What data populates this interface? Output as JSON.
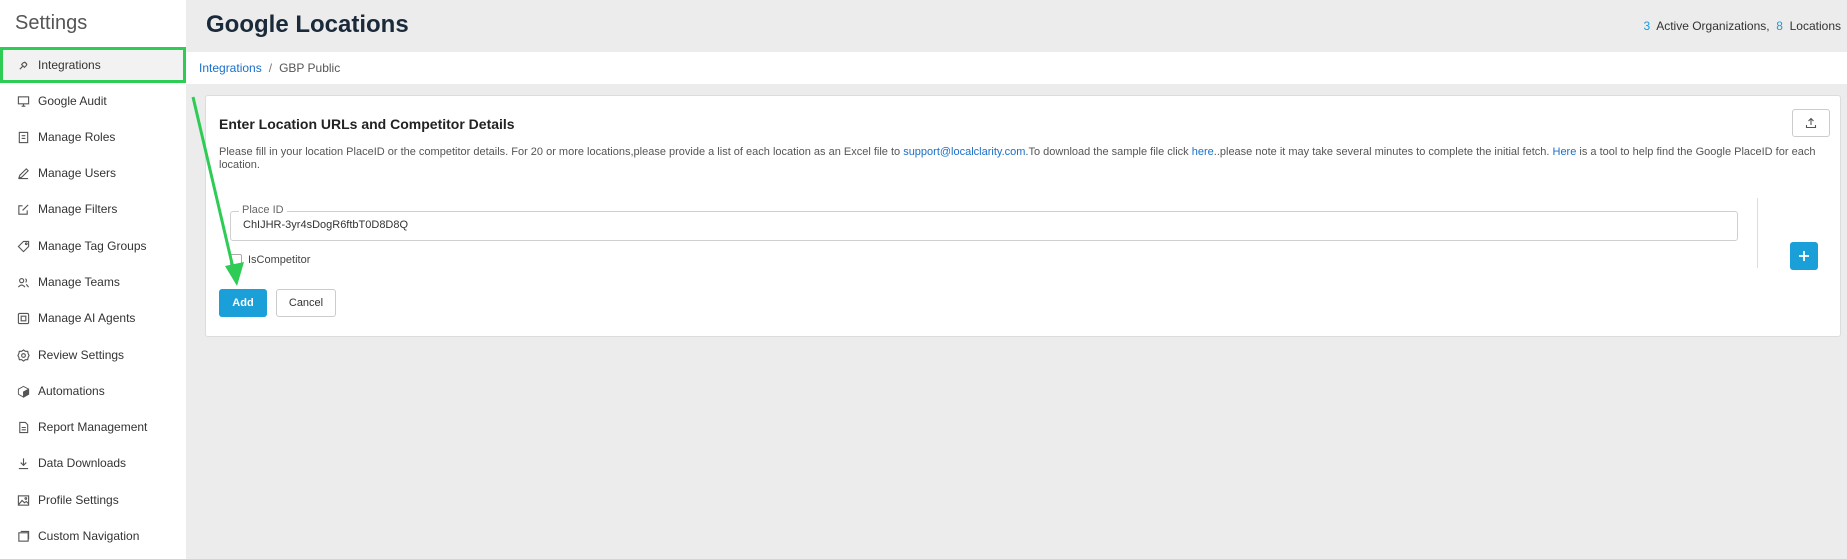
{
  "sidebar": {
    "title": "Settings",
    "items": [
      {
        "label": "Integrations",
        "icon": "plug-icon",
        "active": true
      },
      {
        "label": "Google Audit",
        "icon": "monitor-icon"
      },
      {
        "label": "Manage Roles",
        "icon": "roles-icon"
      },
      {
        "label": "Manage Users",
        "icon": "pencil-icon"
      },
      {
        "label": "Manage Filters",
        "icon": "edit-box-icon"
      },
      {
        "label": "Manage Tag Groups",
        "icon": "tag-icon"
      },
      {
        "label": "Manage Teams",
        "icon": "team-icon"
      },
      {
        "label": "Manage AI Agents",
        "icon": "ai-agent-icon"
      },
      {
        "label": "Review Settings",
        "icon": "gear-icon"
      },
      {
        "label": "Automations",
        "icon": "cube-icon"
      },
      {
        "label": "Report Management",
        "icon": "report-icon"
      },
      {
        "label": "Data Downloads",
        "icon": "download-icon"
      },
      {
        "label": "Profile Settings",
        "icon": "image-icon"
      },
      {
        "label": "Custom Navigation",
        "icon": "nav-icon"
      }
    ]
  },
  "header": {
    "title": "Google Locations",
    "org_count": "3",
    "org_label": "Active Organizations,",
    "loc_count": "8",
    "loc_label": "Locations"
  },
  "breadcrumb": {
    "link": "Integrations",
    "separator": "/",
    "current": "GBP Public"
  },
  "card": {
    "title": "Enter Location URLs and Competitor Details",
    "desc_part1": "Please fill in your location PlaceID or the competitor details. For 20 or more locations,please provide a list of each location as an Excel file to ",
    "desc_email": "support@localclarity.com",
    "desc_part2": ".To download the sample file click ",
    "desc_here1": "here",
    "desc_part3": "..please note it may take several minutes to complete the initial fetch. ",
    "desc_here2": "Here",
    "desc_part4": " is a tool to help find the Google PlaceID for each location.",
    "field_label": "Place ID",
    "field_value": "ChIJHR-3yr4sDogR6ftbT0D8D8Q",
    "checkbox_label": "IsCompetitor",
    "add_label": "Add",
    "cancel_label": "Cancel"
  },
  "colors": {
    "accent": "#1a9fd9",
    "highlight": "#2ecc55",
    "link": "#1a6fc9"
  }
}
